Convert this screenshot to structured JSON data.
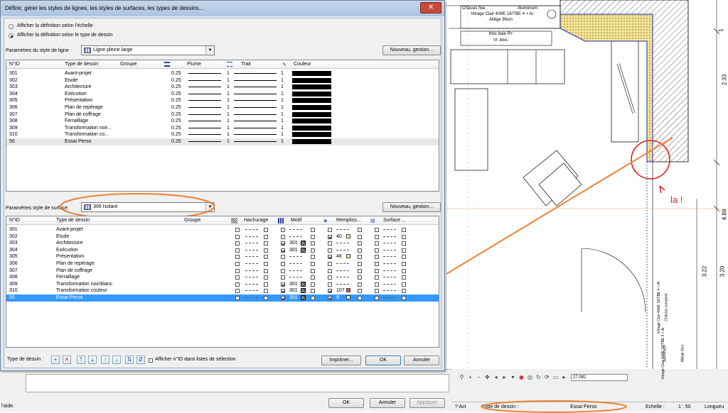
{
  "dialog": {
    "title": "Définir, gérer les styles de lignes, les styles de surfaces, les types de dessins...",
    "radio_scale": "Afficher la définition selon l'échelle",
    "radio_type": "Afficher la définition selon le type de dessin",
    "line_style_label": "Paramètres du style de ligne",
    "line_style_value": "Ligne pleine large",
    "new_manage_button": "Nouveau, gestion...",
    "surface_style_label": "Paramètres style de surface",
    "surface_style_value": "306 Isolant",
    "new_manage_button_2": "Nouveau, gestion...",
    "type_label": "Type de dessin :",
    "show_id_label": "Afficher n°ID dans listes de sélection",
    "print_button": "Imprimer...",
    "ok_button": "OK",
    "cancel_button": "Annuler",
    "help_text": "l'aide."
  },
  "line_table": {
    "headers": [
      "N°ID",
      "Type de dessin",
      "Groupe",
      "Plume",
      "Trait",
      "Couleur"
    ],
    "rows": [
      {
        "id": "301",
        "type": "Avant-projet",
        "pen": "0.25",
        "trait": "1",
        "color": "1"
      },
      {
        "id": "302",
        "type": "Etude",
        "pen": "0.25",
        "trait": "1",
        "color": "1"
      },
      {
        "id": "303",
        "type": "Architecture",
        "pen": "0.25",
        "trait": "1",
        "color": "1"
      },
      {
        "id": "304",
        "type": "Exécution",
        "pen": "0.25",
        "trait": "1",
        "color": "1"
      },
      {
        "id": "305",
        "type": "Présentation",
        "pen": "0.25",
        "trait": "1",
        "color": "1"
      },
      {
        "id": "306",
        "type": "Plan de repérage",
        "pen": "0.25",
        "trait": "1",
        "color": "1"
      },
      {
        "id": "307",
        "type": "Plan de coffrage",
        "pen": "0.25",
        "trait": "1",
        "color": "1"
      },
      {
        "id": "308",
        "type": "Ferraillage",
        "pen": "0.25",
        "trait": "1",
        "color": "1"
      },
      {
        "id": "309",
        "type": "Transformation noir...",
        "pen": "0.25",
        "trait": "1",
        "color": "1"
      },
      {
        "id": "310",
        "type": "Transformation co...",
        "pen": "0.25",
        "trait": "1",
        "color": "1"
      },
      {
        "id": "50",
        "type": "Essai Perso",
        "pen": "0.25",
        "trait": "1",
        "color": "1"
      }
    ]
  },
  "surface_table": {
    "headers": [
      "N°ID",
      "Type de dessin",
      "Groupe",
      "Hachurage",
      "Motif",
      "Rempliss...",
      "Surface ..."
    ],
    "rows": [
      {
        "id": "301",
        "type": "Avant-projet",
        "motif": "",
        "fill": "",
        "m": false,
        "f": false
      },
      {
        "id": "302",
        "type": "Etude",
        "motif": "",
        "fill": "40",
        "m": false,
        "f": true
      },
      {
        "id": "303",
        "type": "Architecture",
        "motif": "301",
        "fill": "",
        "m": true,
        "f": false
      },
      {
        "id": "304",
        "type": "Exécution",
        "motif": "301",
        "fill": "",
        "m": true,
        "f": false
      },
      {
        "id": "305",
        "type": "Présentation",
        "motif": "",
        "fill": "46",
        "m": false,
        "f": true
      },
      {
        "id": "306",
        "type": "Plan de repérage",
        "motif": "",
        "fill": "",
        "m": false,
        "f": false
      },
      {
        "id": "307",
        "type": "Plan de coffrage",
        "motif": "",
        "fill": "",
        "m": false,
        "f": false
      },
      {
        "id": "308",
        "type": "Ferraillage",
        "motif": "",
        "fill": "",
        "m": false,
        "f": false
      },
      {
        "id": "309",
        "type": "Transformation noir/blanc",
        "motif": "301",
        "fill": "",
        "m": true,
        "f": false
      },
      {
        "id": "310",
        "type": "Transformation couleur",
        "motif": "301",
        "fill": "107",
        "m": true,
        "f": true
      },
      {
        "id": "50",
        "type": "Essai Perso",
        "motif": "301",
        "fill": "9",
        "m": true,
        "f": true
      }
    ],
    "selected": "50"
  },
  "bg_window": {
    "ok": "OK",
    "cancel": "Annuler",
    "apply": "Appliquer"
  },
  "cad": {
    "label1": "Châssis fixe",
    "label2": "Aluminium",
    "label3": "Vitrage Clair 4/WE 16/TBE 4 + Ar",
    "label4": "Allège 90cm",
    "label5": "bloc baie R+",
    "label6": "Vr. élec.",
    "annotation": "la !",
    "dim1": "2.33",
    "dim2": "4.89",
    "dim3": "3.22",
    "dim4": "3.20",
    "dim5": "1",
    "vlabel1": "Châssis composé",
    "vlabel2": "Vitrage Clair 4/WE 16/TBE 4 + Ar",
    "vlabel3": "Aluminium",
    "vlabel4": "Vitrage Clair 4/WE 16/TBE 4 + Ar",
    "vlabel5": "Allège 0cm",
    "zoom_value": "27.082"
  },
  "status": {
    "act": "? Act",
    "type_label": "Type de dessin :",
    "type_value": "Essai Perso",
    "scale_label": "Echelle :",
    "scale_value": "1 : 50",
    "length_label": "Longueu"
  },
  "colors": {
    "accent": "#3399ff",
    "highlight": "#f08030",
    "mark": "#e02020"
  }
}
